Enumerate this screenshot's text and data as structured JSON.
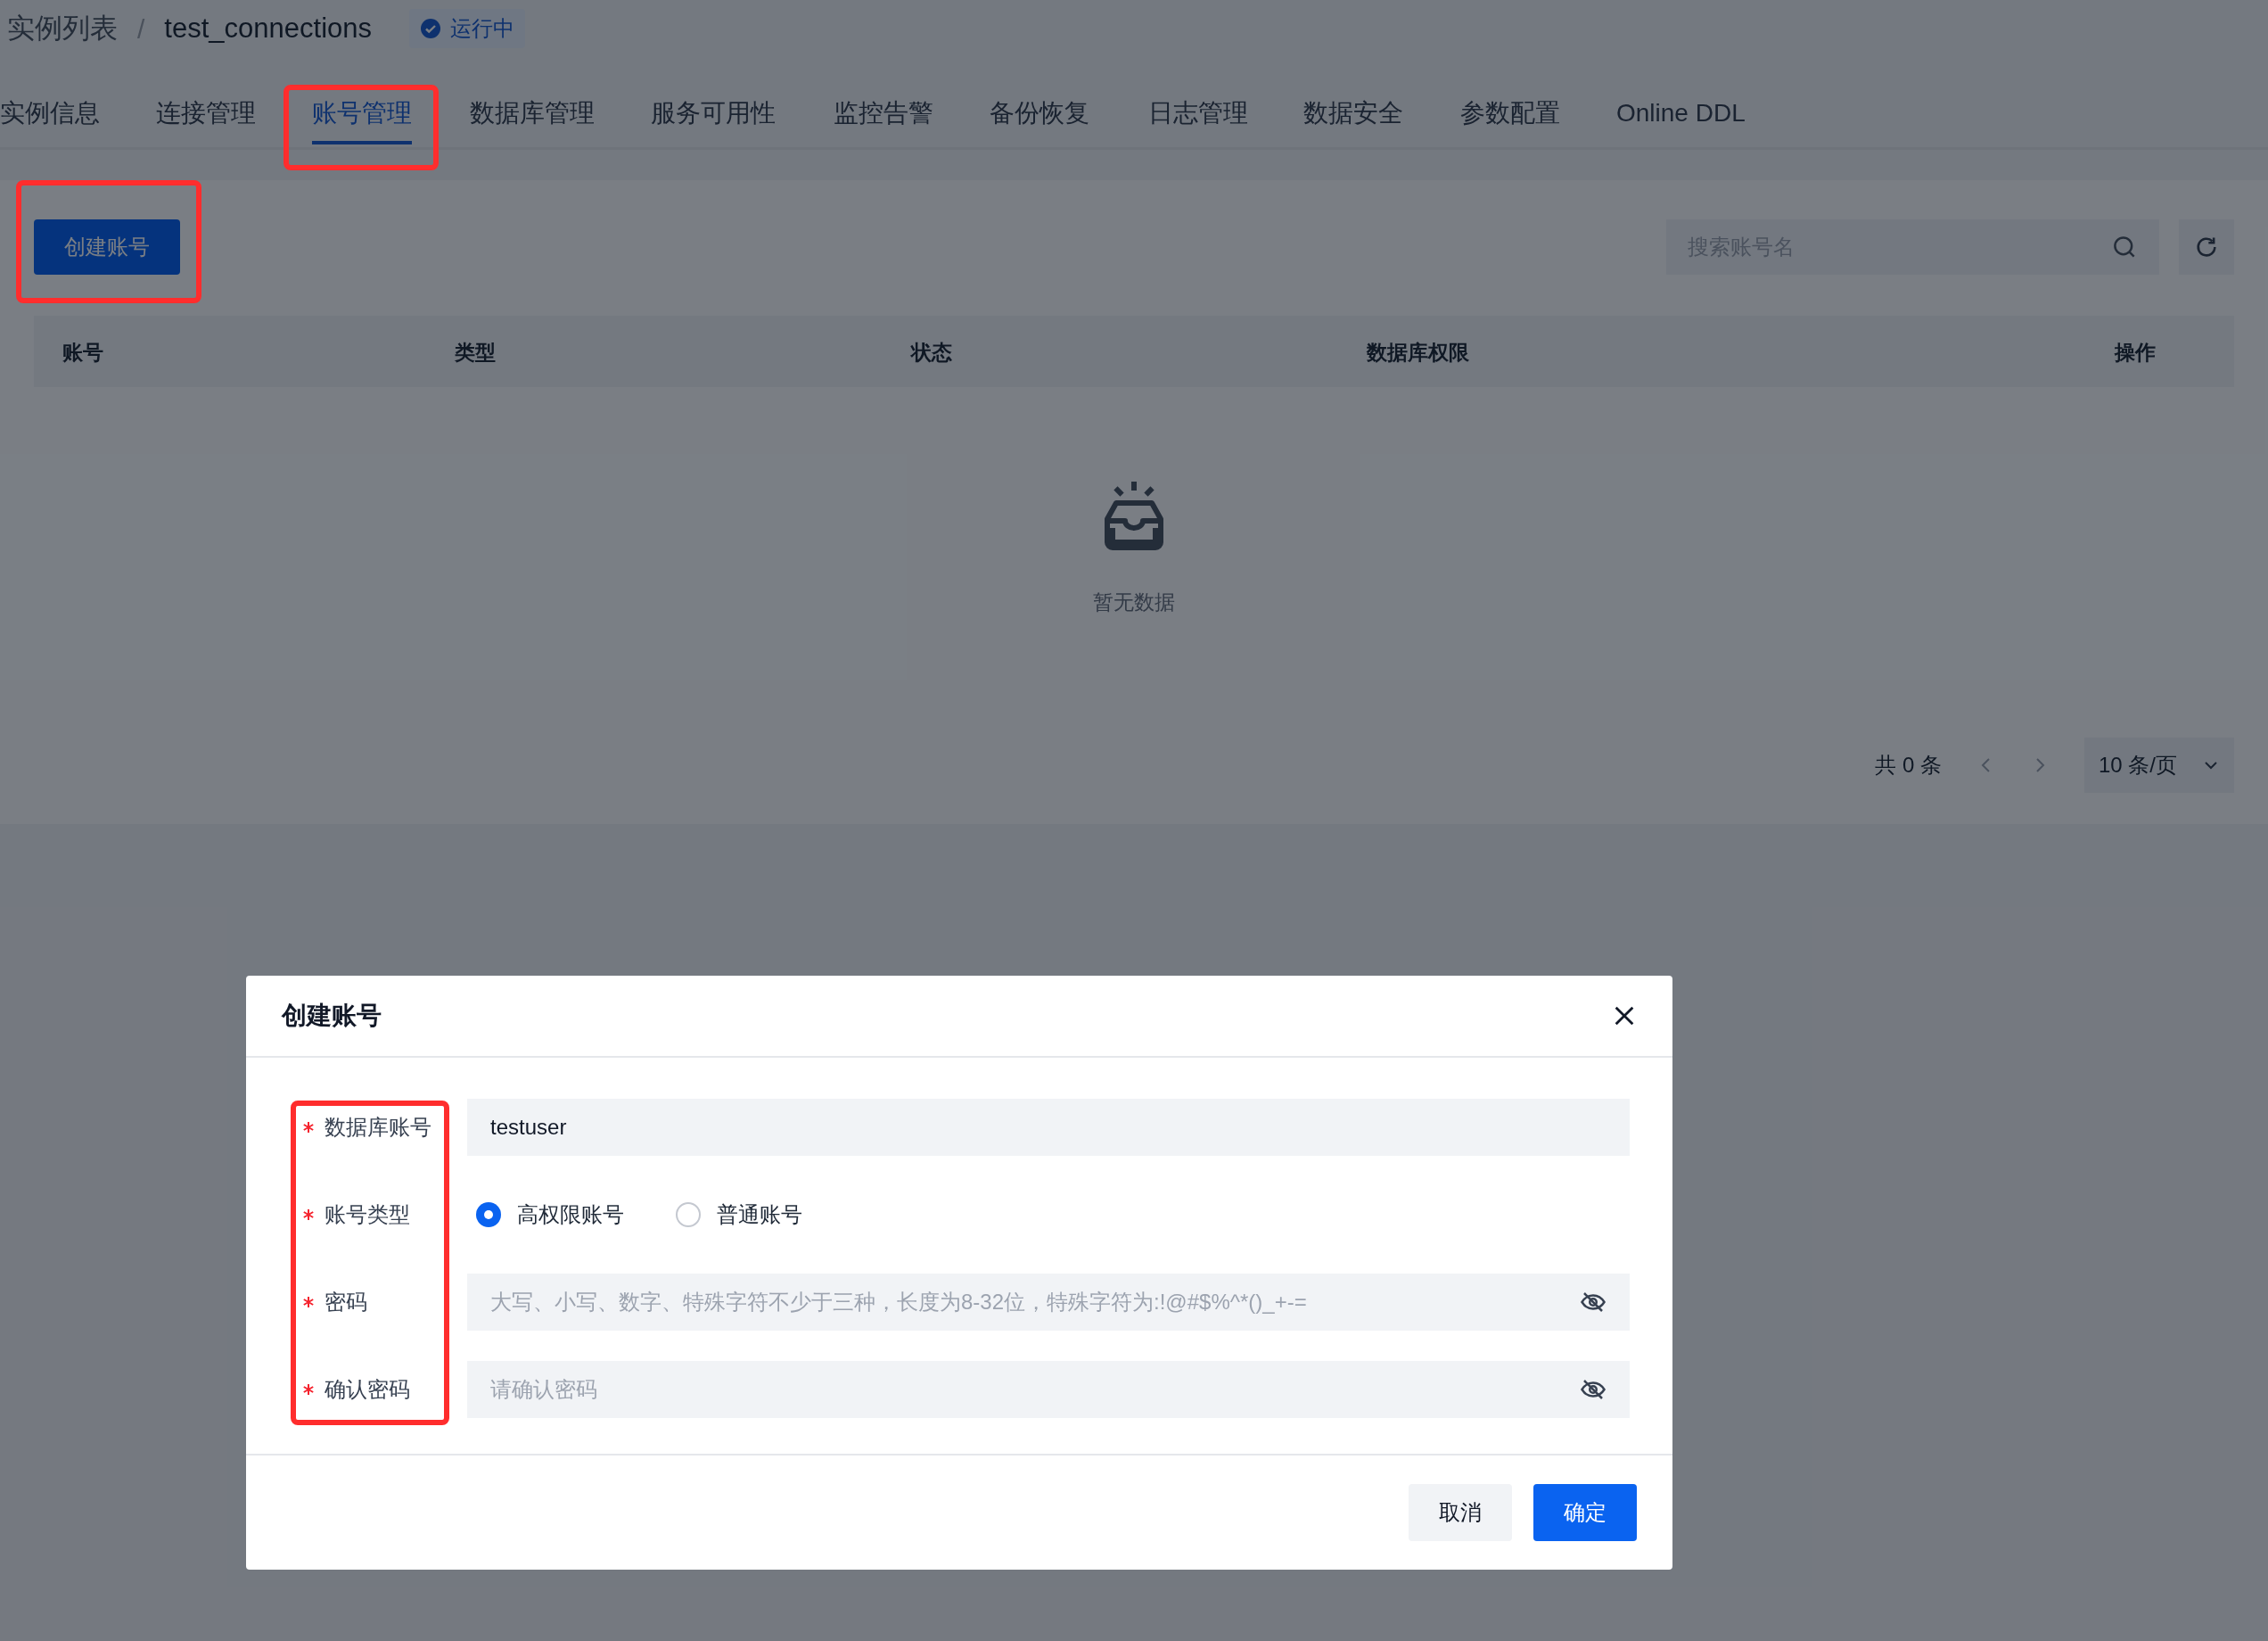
{
  "breadcrumb": {
    "items": [
      "实例列表",
      "test_connections"
    ],
    "separator": "/",
    "status": {
      "label": "运行中"
    }
  },
  "tabs": [
    {
      "label": "实例信息",
      "selected": false,
      "highlighted": false
    },
    {
      "label": "连接管理",
      "selected": false,
      "highlighted": false
    },
    {
      "label": "账号管理",
      "selected": true,
      "highlighted": true
    },
    {
      "label": "数据库管理",
      "selected": false,
      "highlighted": false
    },
    {
      "label": "服务可用性",
      "selected": false,
      "highlighted": false
    },
    {
      "label": "监控告警",
      "selected": false,
      "highlighted": false
    },
    {
      "label": "备份恢复",
      "selected": false,
      "highlighted": false
    },
    {
      "label": "日志管理",
      "selected": false,
      "highlighted": false
    },
    {
      "label": "数据安全",
      "selected": false,
      "highlighted": false
    },
    {
      "label": "参数配置",
      "selected": false,
      "highlighted": false
    },
    {
      "label": "Online DDL",
      "selected": false,
      "highlighted": false
    }
  ],
  "toolbar": {
    "create_button": {
      "label": "创建账号",
      "highlighted": true
    },
    "search": {
      "placeholder": "搜索账号名"
    }
  },
  "table": {
    "columns": [
      "账号",
      "类型",
      "状态",
      "数据库权限",
      "操作"
    ],
    "empty_text": "暂无数据"
  },
  "pagination": {
    "total": "共 0 条",
    "page_size": "10 条/页"
  },
  "dialog": {
    "title": "创建账号",
    "labels_highlighted": true,
    "fields": [
      {
        "kind": "text",
        "label": "数据库账号",
        "required": true,
        "value": "testuser"
      },
      {
        "kind": "radio",
        "label": "账号类型",
        "required": true,
        "options": [
          {
            "label": "高权限账号",
            "selected": true
          },
          {
            "label": "普通账号",
            "selected": false
          }
        ]
      },
      {
        "kind": "password",
        "label": "密码",
        "required": true,
        "placeholder": "大写、小写、数字、特殊字符不少于三种，长度为8-32位，特殊字符为:!@#$%^*()_+-="
      },
      {
        "kind": "password",
        "label": "确认密码",
        "required": true,
        "placeholder": "请确认密码"
      }
    ],
    "buttons": [
      {
        "label": "取消",
        "kind": "secondary"
      },
      {
        "label": "确定",
        "kind": "primary"
      }
    ]
  }
}
